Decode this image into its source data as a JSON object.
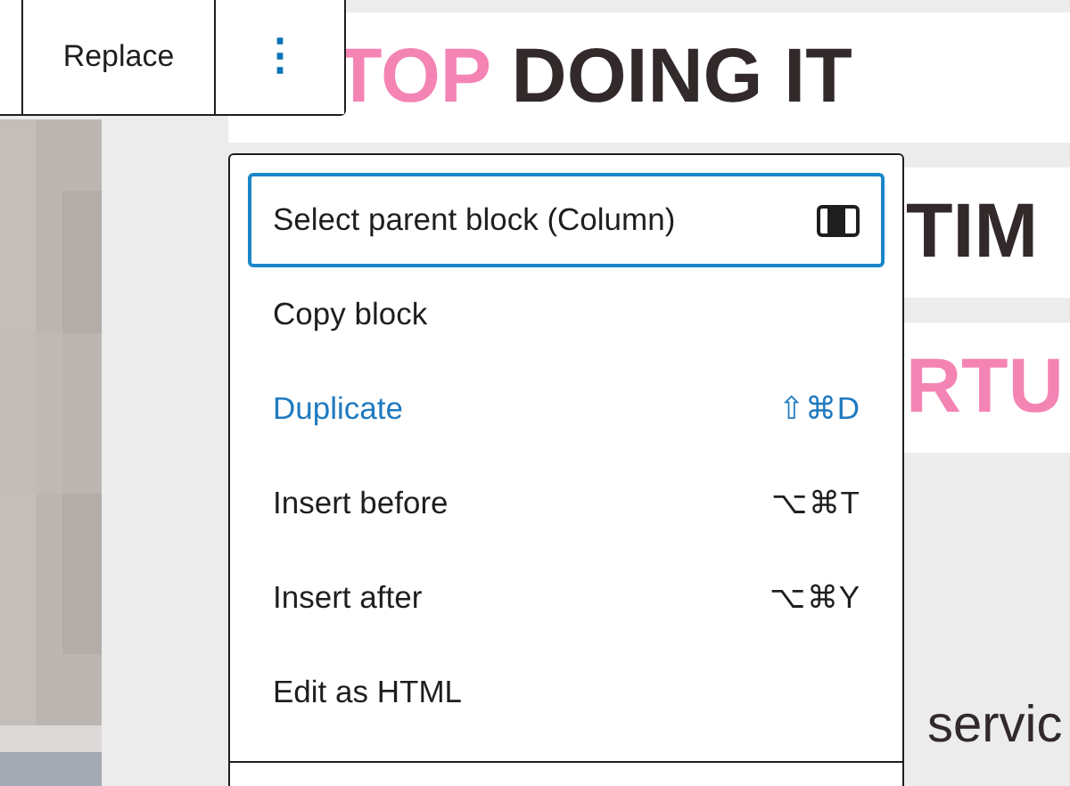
{
  "toolbar": {
    "buttons": [
      {
        "kind": "text",
        "label": "Replace"
      },
      {
        "kind": "more",
        "label": "⋮"
      }
    ]
  },
  "heading_lines": [
    {
      "segments": [
        {
          "text": "TOP",
          "color": "#f484b4"
        },
        {
          "text": " DOING IT",
          "color": "#322a2a"
        }
      ]
    },
    {
      "segments": [
        {
          "text": "TIM",
          "color": "#322a2a"
        }
      ]
    },
    {
      "segments": [
        {
          "text": "RTU",
          "color": "#f484b4"
        }
      ]
    }
  ],
  "body_text": "servic",
  "menu": {
    "items": [
      {
        "label": "Select parent block (Column)",
        "kind": "parent",
        "selected": true,
        "highlight": false
      },
      {
        "label": "Copy block",
        "kind": "plain",
        "selected": false,
        "highlight": false
      },
      {
        "label": "Duplicate",
        "kind": "shortcut",
        "shortcut": "⇧⌘D",
        "selected": false,
        "highlight": true
      },
      {
        "label": "Insert before",
        "kind": "shortcut",
        "shortcut": "⌥⌘T",
        "selected": false,
        "highlight": false
      },
      {
        "label": "Insert after",
        "kind": "shortcut",
        "shortcut": "⌥⌘Y",
        "selected": false,
        "highlight": false
      },
      {
        "label": "Edit as HTML",
        "kind": "plain",
        "selected": false,
        "highlight": false
      }
    ]
  }
}
